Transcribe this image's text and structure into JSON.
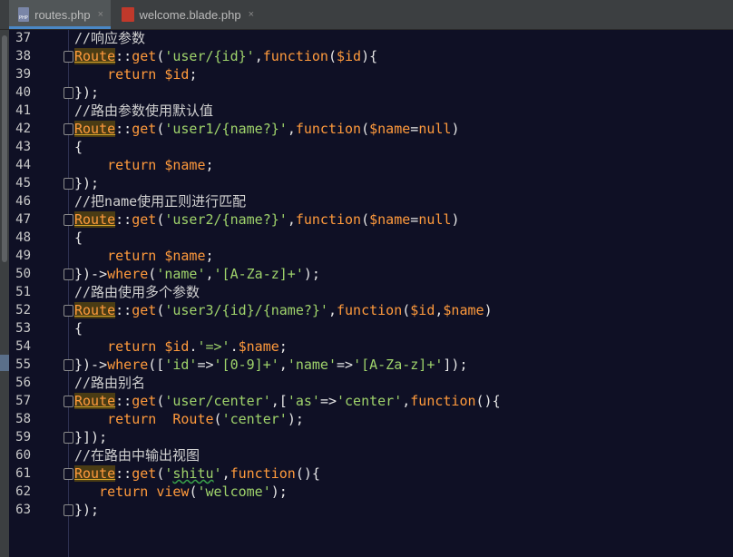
{
  "tabs": [
    {
      "label": "routes.php",
      "close": "×",
      "active": true
    },
    {
      "label": "welcome.blade.php",
      "close": "×",
      "active": false
    }
  ],
  "code_lines": [
    {
      "num": "37",
      "fold": false,
      "tokens": [
        [
          "c-comment",
          "//响应参数"
        ]
      ]
    },
    {
      "num": "38",
      "fold": true,
      "tokens": [
        [
          "c-route",
          "Route"
        ],
        [
          "c-plain",
          "::"
        ],
        [
          "c-fn",
          "get"
        ],
        [
          "c-plain",
          "("
        ],
        [
          "c-str",
          "'user/{id}'"
        ],
        [
          "c-plain",
          ","
        ],
        [
          "c-kw",
          "function"
        ],
        [
          "c-plain",
          "("
        ],
        [
          "c-var",
          "$id"
        ],
        [
          "c-plain",
          "){"
        ]
      ]
    },
    {
      "num": "39",
      "fold": false,
      "tokens": [
        [
          "c-plain",
          "    "
        ],
        [
          "c-kw",
          "return "
        ],
        [
          "c-var",
          "$id"
        ],
        [
          "c-plain",
          ";"
        ]
      ]
    },
    {
      "num": "40",
      "fold": true,
      "tokens": [
        [
          "c-plain",
          "});"
        ]
      ]
    },
    {
      "num": "41",
      "fold": false,
      "tokens": [
        [
          "c-comment",
          "//路由参数使用默认值"
        ]
      ]
    },
    {
      "num": "42",
      "fold": true,
      "tokens": [
        [
          "c-route",
          "Route"
        ],
        [
          "c-plain",
          "::"
        ],
        [
          "c-fn",
          "get"
        ],
        [
          "c-plain",
          "("
        ],
        [
          "c-str",
          "'user1/{name?}'"
        ],
        [
          "c-plain",
          ","
        ],
        [
          "c-kw",
          "function"
        ],
        [
          "c-plain",
          "("
        ],
        [
          "c-var",
          "$name"
        ],
        [
          "c-plain",
          "="
        ],
        [
          "c-kw",
          "null"
        ],
        [
          "c-plain",
          ")"
        ]
      ]
    },
    {
      "num": "43",
      "fold": false,
      "tokens": [
        [
          "c-plain",
          "{"
        ]
      ]
    },
    {
      "num": "44",
      "fold": false,
      "tokens": [
        [
          "c-plain",
          "    "
        ],
        [
          "c-kw",
          "return "
        ],
        [
          "c-var",
          "$name"
        ],
        [
          "c-plain",
          ";"
        ]
      ]
    },
    {
      "num": "45",
      "fold": true,
      "tokens": [
        [
          "c-plain",
          "});"
        ]
      ]
    },
    {
      "num": "46",
      "fold": false,
      "tokens": [
        [
          "c-comment",
          "//把name使用正则进行匹配"
        ]
      ]
    },
    {
      "num": "47",
      "fold": true,
      "tokens": [
        [
          "c-route",
          "Route"
        ],
        [
          "c-plain",
          "::"
        ],
        [
          "c-fn",
          "get"
        ],
        [
          "c-plain",
          "("
        ],
        [
          "c-str",
          "'user2/{name?}'"
        ],
        [
          "c-plain",
          ","
        ],
        [
          "c-kw",
          "function"
        ],
        [
          "c-plain",
          "("
        ],
        [
          "c-var",
          "$name"
        ],
        [
          "c-plain",
          "="
        ],
        [
          "c-kw",
          "null"
        ],
        [
          "c-plain",
          ")"
        ]
      ]
    },
    {
      "num": "48",
      "fold": false,
      "tokens": [
        [
          "c-plain",
          "{"
        ]
      ]
    },
    {
      "num": "49",
      "fold": false,
      "tokens": [
        [
          "c-plain",
          "    "
        ],
        [
          "c-kw",
          "return "
        ],
        [
          "c-var",
          "$name"
        ],
        [
          "c-plain",
          ";"
        ]
      ]
    },
    {
      "num": "50",
      "fold": true,
      "tokens": [
        [
          "c-plain",
          "})->"
        ],
        [
          "c-fn",
          "where"
        ],
        [
          "c-plain",
          "("
        ],
        [
          "c-str",
          "'name'"
        ],
        [
          "c-plain",
          ","
        ],
        [
          "c-str",
          "'[A-Za-z]+'"
        ],
        [
          "c-plain",
          ");"
        ]
      ]
    },
    {
      "num": "51",
      "fold": false,
      "tokens": [
        [
          "c-comment",
          "//路由使用多个参数"
        ]
      ]
    },
    {
      "num": "52",
      "fold": true,
      "tokens": [
        [
          "c-route",
          "Route"
        ],
        [
          "c-plain",
          "::"
        ],
        [
          "c-fn",
          "get"
        ],
        [
          "c-plain",
          "("
        ],
        [
          "c-str",
          "'user3/{id}/{name?}'"
        ],
        [
          "c-plain",
          ","
        ],
        [
          "c-kw",
          "function"
        ],
        [
          "c-plain",
          "("
        ],
        [
          "c-var",
          "$id"
        ],
        [
          "c-plain",
          ","
        ],
        [
          "c-var",
          "$name"
        ],
        [
          "c-plain",
          ")"
        ]
      ]
    },
    {
      "num": "53",
      "fold": false,
      "tokens": [
        [
          "c-plain",
          "{"
        ]
      ]
    },
    {
      "num": "54",
      "fold": false,
      "tokens": [
        [
          "c-plain",
          "    "
        ],
        [
          "c-kw",
          "return "
        ],
        [
          "c-var",
          "$id"
        ],
        [
          "c-plain",
          "."
        ],
        [
          "c-str",
          "'=>'"
        ],
        [
          "c-plain",
          "."
        ],
        [
          "c-var",
          "$name"
        ],
        [
          "c-plain",
          ";"
        ]
      ]
    },
    {
      "num": "55",
      "fold": true,
      "tokens": [
        [
          "c-plain",
          "})->"
        ],
        [
          "c-fn",
          "where"
        ],
        [
          "c-plain",
          "(["
        ],
        [
          "c-str",
          "'id'"
        ],
        [
          "c-plain",
          "=>"
        ],
        [
          "c-str",
          "'[0-9]+'"
        ],
        [
          "c-plain",
          ","
        ],
        [
          "c-str",
          "'name'"
        ],
        [
          "c-plain",
          "=>"
        ],
        [
          "c-str",
          "'[A-Za-z]+'"
        ],
        [
          "c-plain",
          "]);"
        ]
      ]
    },
    {
      "num": "56",
      "fold": false,
      "tokens": [
        [
          "c-comment",
          "//路由别名"
        ]
      ]
    },
    {
      "num": "57",
      "fold": true,
      "tokens": [
        [
          "c-route",
          "Route"
        ],
        [
          "c-plain",
          "::"
        ],
        [
          "c-fn",
          "get"
        ],
        [
          "c-plain",
          "("
        ],
        [
          "c-str",
          "'user/center'"
        ],
        [
          "c-plain",
          ",["
        ],
        [
          "c-str",
          "'as'"
        ],
        [
          "c-plain",
          "=>"
        ],
        [
          "c-str",
          "'center'"
        ],
        [
          "c-plain",
          ","
        ],
        [
          "c-kw",
          "function"
        ],
        [
          "c-plain",
          "(){"
        ]
      ]
    },
    {
      "num": "58",
      "fold": false,
      "tokens": [
        [
          "c-plain",
          "    "
        ],
        [
          "c-kw",
          "return  "
        ],
        [
          "c-fn",
          "Route"
        ],
        [
          "c-plain",
          "("
        ],
        [
          "c-str",
          "'center'"
        ],
        [
          "c-plain",
          ");"
        ]
      ]
    },
    {
      "num": "59",
      "fold": true,
      "tokens": [
        [
          "c-plain",
          "}]);"
        ]
      ]
    },
    {
      "num": "60",
      "fold": false,
      "tokens": [
        [
          "c-comment",
          "//在路由中输出视图"
        ]
      ]
    },
    {
      "num": "61",
      "fold": true,
      "tokens": [
        [
          "c-route",
          "Route"
        ],
        [
          "c-plain",
          "::"
        ],
        [
          "c-fn",
          "get"
        ],
        [
          "c-plain",
          "("
        ],
        [
          "c-str",
          "'"
        ],
        [
          "c-str c-wave",
          "shitu"
        ],
        [
          "c-str",
          "'"
        ],
        [
          "c-plain",
          ","
        ],
        [
          "c-kw",
          "function"
        ],
        [
          "c-plain",
          "(){"
        ]
      ]
    },
    {
      "num": "62",
      "fold": false,
      "tokens": [
        [
          "c-plain",
          "   "
        ],
        [
          "c-kw",
          "return "
        ],
        [
          "c-fn",
          "view"
        ],
        [
          "c-plain",
          "("
        ],
        [
          "c-str",
          "'welcome'"
        ],
        [
          "c-plain",
          ");"
        ]
      ]
    },
    {
      "num": "63",
      "fold": true,
      "tokens": [
        [
          "c-plain",
          "});"
        ]
      ]
    }
  ]
}
